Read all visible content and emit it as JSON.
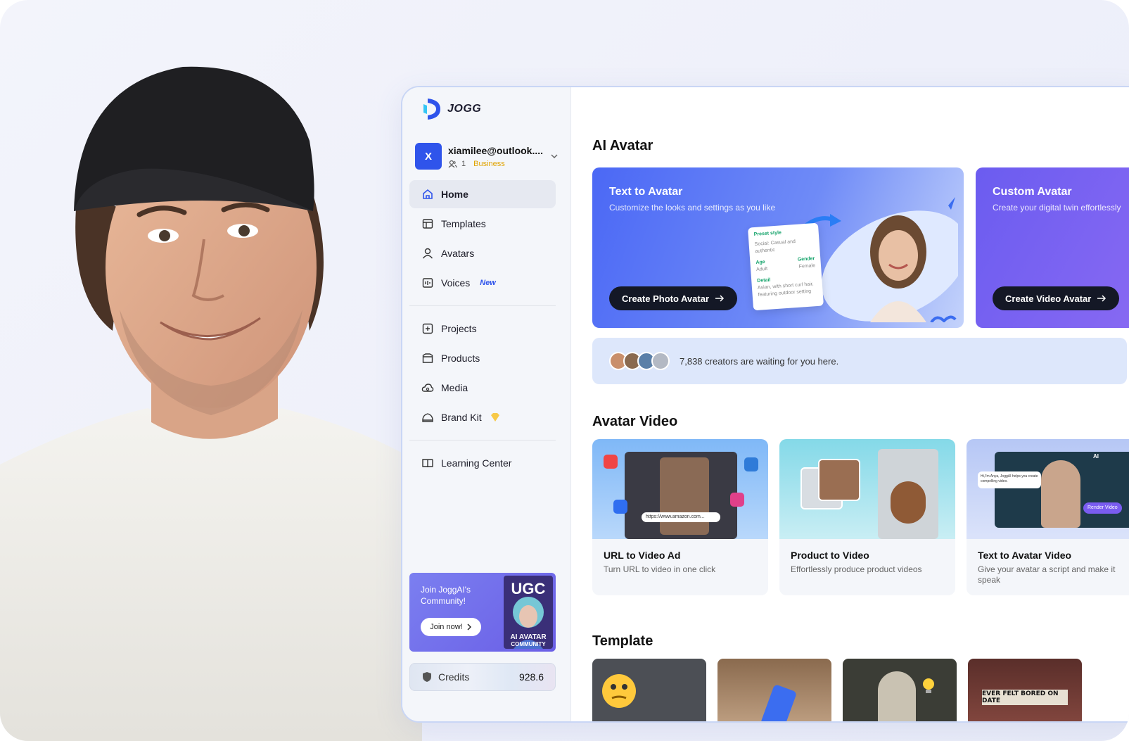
{
  "app": {
    "logo_text": "JOGG"
  },
  "account": {
    "initial": "X",
    "email": "xiamilee@outlook....",
    "members": "1",
    "plan": "Business"
  },
  "nav": {
    "home": "Home",
    "templates": "Templates",
    "avatars": "Avatars",
    "voices": "Voices",
    "voices_badge": "New",
    "projects": "Projects",
    "products": "Products",
    "media": "Media",
    "brand_kit": "Brand Kit",
    "learning_center": "Learning Center"
  },
  "community": {
    "text": "Join JoggAI's Community!",
    "button": "Join now!",
    "image_title": "UGC",
    "image_caption_1": "AI AVATAR",
    "image_caption_2": "COMMUNITY"
  },
  "credits": {
    "label": "Credits",
    "value": "928.6"
  },
  "sections": {
    "ai_avatar": "AI Avatar",
    "avatar_video": "Avatar Video",
    "template": "Template"
  },
  "hero_cards": [
    {
      "title": "Text to Avatar",
      "subtitle": "Customize the looks and settings as you like",
      "button": "Create Photo Avatar",
      "panel": {
        "preset_label": "Preset style",
        "preset_value": "Social: Casual and authentic",
        "age_label": "Age",
        "age_value": "Adult",
        "gender_label": "Gender",
        "gender_value": "Female",
        "detail_label": "Detail",
        "detail_value": "Asian, with short curl hair, featuring outdoor setting"
      }
    },
    {
      "title": "Custom Avatar",
      "subtitle": "Create your digital twin effortlessly",
      "button": "Create Video Avatar"
    }
  ],
  "creators": {
    "text": "7,838 creators are waiting for you here."
  },
  "video_cards": [
    {
      "title": "URL to Video Ad",
      "desc": "Turn URL to video in one click",
      "url_bar": "https://www.amazon.com..."
    },
    {
      "title": "Product to Video",
      "desc": "Effortlessly produce product videos"
    },
    {
      "title": "Text to Avatar Video",
      "desc": "Give your avatar a script and make it speak",
      "bubble": "Hi,I'm Anya, JoggAI helps you create compelling video.",
      "render": "Render Video",
      "ai_tag": "AI"
    }
  ],
  "template_cards": [
    {
      "caption": ""
    },
    {
      "caption": ""
    },
    {
      "caption": ""
    },
    {
      "caption": "EVER FELT BORED ON DATE"
    }
  ],
  "colors": {
    "primary": "#2f54eb",
    "hero_blue": "#4a6cf7",
    "hero_purple": "#7b5cf0",
    "dark_button": "#141826",
    "plan_badge": "#e0a300"
  }
}
